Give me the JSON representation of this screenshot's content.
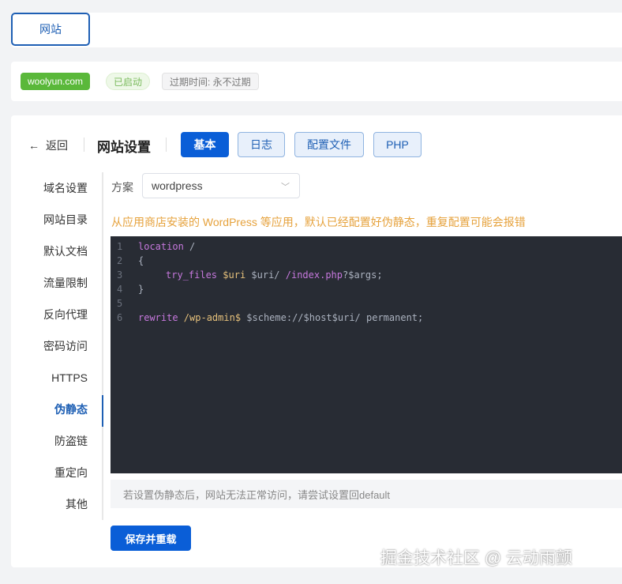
{
  "top_tab": "网站",
  "site": {
    "domain": "woolyun.com",
    "status": "已启动",
    "expiry": "过期时间: 永不过期"
  },
  "header": {
    "back": "返回",
    "title": "网站设置",
    "tabs": [
      "基本",
      "日志",
      "配置文件",
      "PHP"
    ]
  },
  "sidebar": [
    "域名设置",
    "网站目录",
    "默认文档",
    "流量限制",
    "反向代理",
    "密码访问",
    "HTTPS",
    "伪静态",
    "防盗链",
    "重定向",
    "其他"
  ],
  "form": {
    "scheme_label": "方案",
    "scheme_value": "wordpress",
    "warning": "从应用商店安装的 WordPress 等应用，默认已经配置好伪静态，重复配置可能会报错",
    "hint": "若设置伪静态后，网站无法正常访问，请尝试设置回default",
    "save": "保存并重载"
  },
  "code": {
    "l1a": "location",
    "l1b": " /",
    "l2": "{",
    "l3a": "try_files",
    "l3b": "$uri",
    "l3c": " $uri/ ",
    "l3d": "/index.php",
    "l3e": "?$args;",
    "l4": "}",
    "l6a": "rewrite",
    "l6b": " /wp-admin$",
    "l6c": " $scheme://$host$uri/ permanent;"
  },
  "watermark": "掘金技术社区 @ 云动雨颤"
}
